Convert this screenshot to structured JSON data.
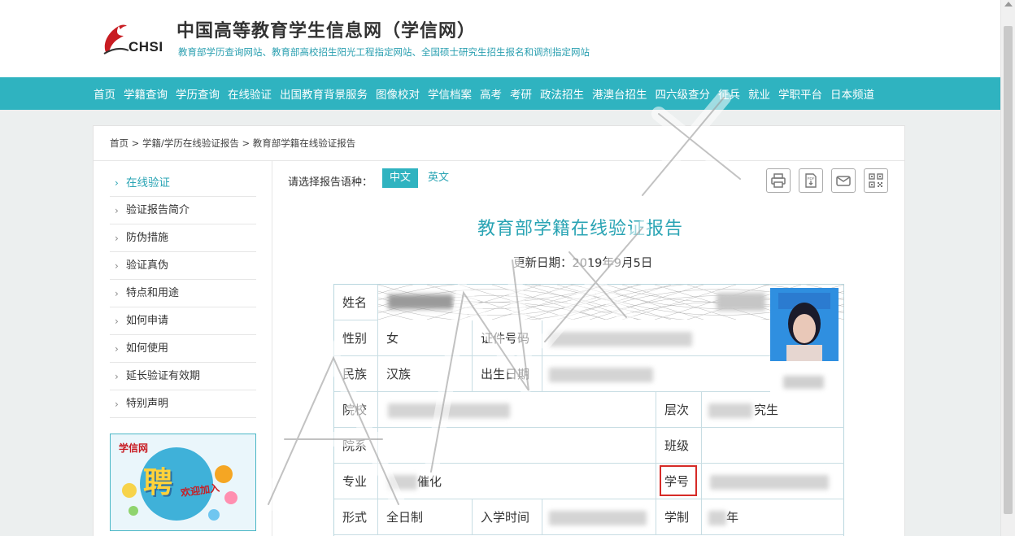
{
  "header": {
    "logo_text": "CHSI",
    "title": "中国高等教育学生信息网（学信网）",
    "subtitle": "教育部学历查询网站、教育部高校招生阳光工程指定网站、全国硕士研究生招生报名和调剂指定网站"
  },
  "nav": {
    "items": [
      "首页",
      "学籍查询",
      "学历查询",
      "在线验证",
      "出国教育背景服务",
      "图像校对",
      "学信档案",
      "高考",
      "考研",
      "政法招生",
      "港澳台招生",
      "四六级查分",
      "征兵",
      "就业",
      "学职平台",
      "日本频道"
    ]
  },
  "breadcrumb": "首页 > 学籍/学历在线验证报告 > 教育部学籍在线验证报告",
  "sidebar": {
    "items": [
      {
        "label": "在线验证"
      },
      {
        "label": "验证报告简介"
      },
      {
        "label": "防伪措施"
      },
      {
        "label": "验证真伪"
      },
      {
        "label": "特点和用途"
      },
      {
        "label": "如何申请"
      },
      {
        "label": "如何使用"
      },
      {
        "label": "延长验证有效期"
      },
      {
        "label": "特别声明"
      }
    ]
  },
  "promo": {
    "logo": "学信网",
    "big": "聘",
    "sub": "欢迎加入"
  },
  "language": {
    "label": "请选择报告语种：",
    "zh": "中文",
    "en": "英文"
  },
  "report": {
    "title": "教育部学籍在线验证报告",
    "update_date": "更新日期：2019年9月5日",
    "labels": {
      "name": "姓名",
      "gender": "性别",
      "id": "证件号码",
      "ethnicity": "民族",
      "birth": "出生日期",
      "school": "院校",
      "level": "层次",
      "department": "院系",
      "class": "班级",
      "major": "专业",
      "student_no": "学号",
      "form": "形式",
      "enroll": "入学时间",
      "duration": "学制"
    },
    "values": {
      "gender": "女",
      "ethnicity": "汉族",
      "form": "全日制",
      "major_suffix": "催化",
      "level_suffix": "究生",
      "duration_suffix": "年"
    }
  },
  "colors": {
    "teal": "#2fb3c0",
    "highlight": "#d62b27"
  },
  "icons": [
    "print-icon",
    "pdf-icon",
    "mail-icon",
    "qrcode-icon",
    "chevron-right-icon"
  ]
}
